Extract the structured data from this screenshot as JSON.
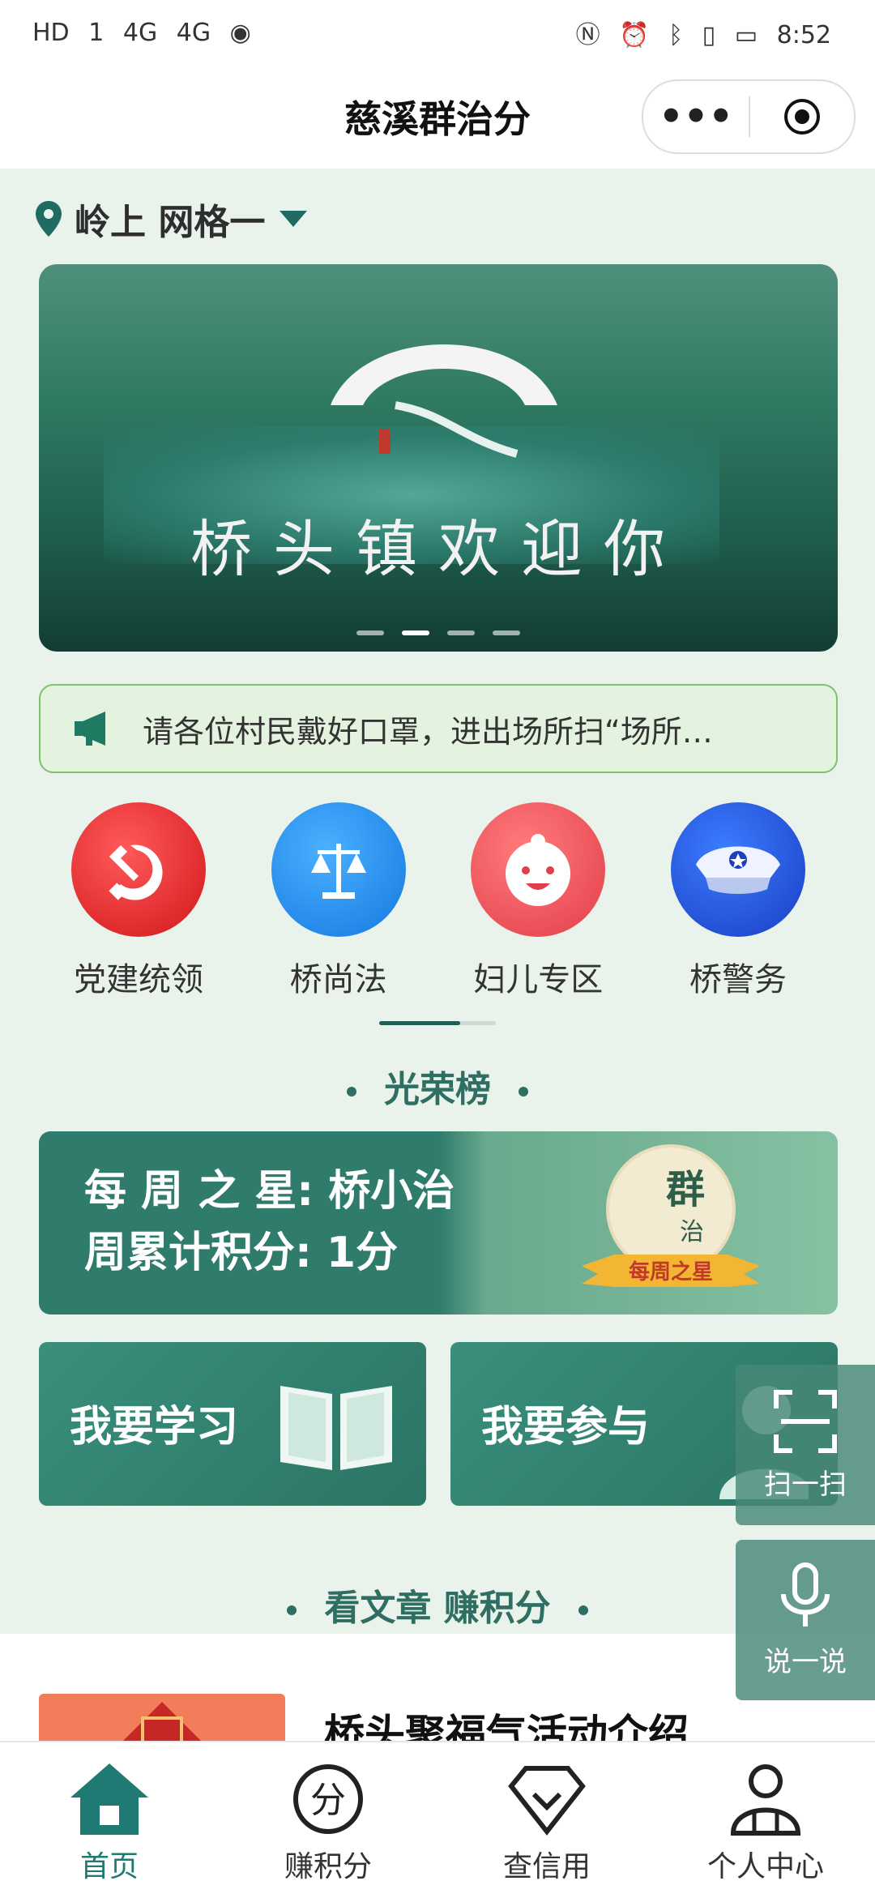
{
  "status_bar": {
    "left_indicators": [
      "HD",
      "1",
      "4G",
      "4G"
    ],
    "time": "8:52"
  },
  "navbar": {
    "title": "慈溪群治分",
    "more_label": "•••"
  },
  "location": {
    "label": "岭上 网格一"
  },
  "banner": {
    "text": "桥头镇欢迎你",
    "dots_total": 4,
    "dots_active_index": 1
  },
  "notice": {
    "text": "请各位村民戴好口罩，进出场所扫“场所…"
  },
  "quick_entries": [
    {
      "label": "党建统领",
      "icon": "party-hammer-sickle-icon"
    },
    {
      "label": "桥尚法",
      "icon": "scales-icon"
    },
    {
      "label": "妇儿专区",
      "icon": "baby-face-icon"
    },
    {
      "label": "桥警务",
      "icon": "police-cap-icon"
    }
  ],
  "honor": {
    "section_title": "光荣榜",
    "line1": "每 周 之 星: 桥小治",
    "line2": "周累计积分: 1分",
    "badge_text": "每周之星",
    "badge_seal": "群治分"
  },
  "cards": {
    "learn": "我要学习",
    "participate": "我要参与"
  },
  "articles": {
    "section_title": "看文章 赚积分",
    "first_title": "桥头聚福气活动介绍"
  },
  "float_buttons": {
    "scan": "扫一扫",
    "speak": "说一说"
  },
  "tabbar": [
    {
      "label": "首页",
      "icon": "home-icon",
      "active": true
    },
    {
      "label": "赚积分",
      "icon": "points-icon",
      "active": false
    },
    {
      "label": "查信用",
      "icon": "credit-icon",
      "active": false
    },
    {
      "label": "个人中心",
      "icon": "person-icon",
      "active": false
    }
  ],
  "colors": {
    "accent": "#1f7a73",
    "page_bg": "#e9f3eb",
    "notice_border": "#7ec26d"
  }
}
